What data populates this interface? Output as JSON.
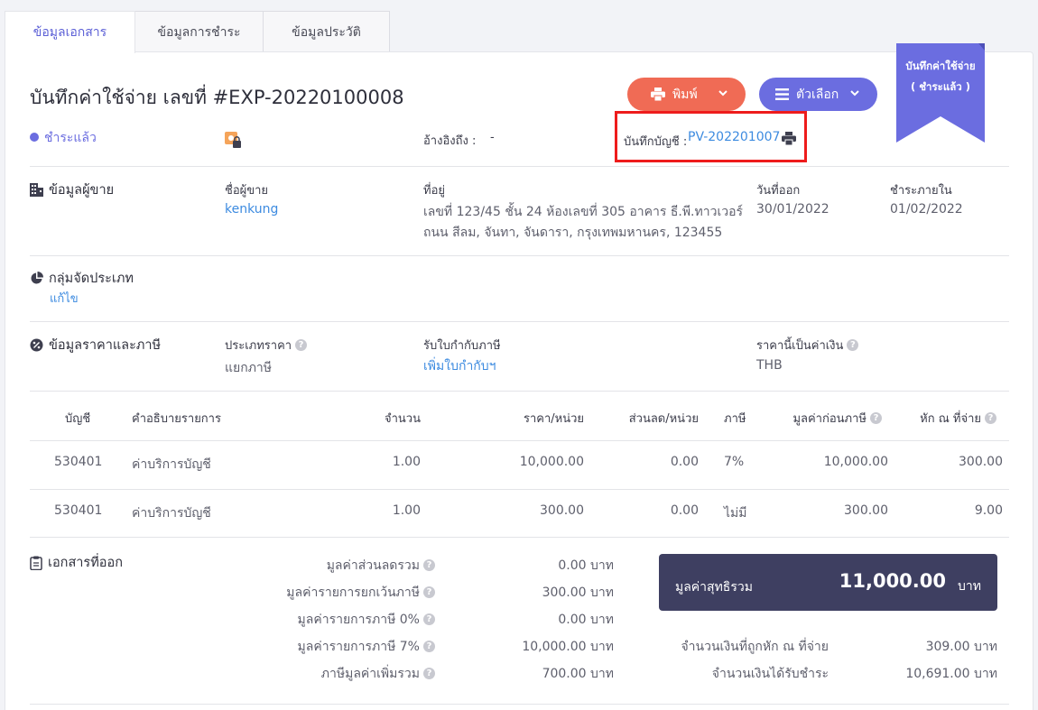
{
  "tabs": [
    "ข้อมูลเอกสาร",
    "ข้อมูลการชำระ",
    "ข้อมูลประวัติ"
  ],
  "header": {
    "title": "บันทึกค่าใช้จ่าย เลขที่ #EXP-20220100008",
    "print_label": "พิมพ์",
    "options_label": "ตัวเลือก",
    "ribbon_line1": "บันทึกค่าใช้จ่าย",
    "ribbon_line2": "( ชำระแล้ว )"
  },
  "status": {
    "label": "ชำระแล้ว",
    "reference_label": "อ้างอิงถึง :",
    "reference_value": "-",
    "account_label": "บันทึกบัญชี :",
    "account_value": "PV-202201007"
  },
  "vendor": {
    "section_title": "ข้อมูลผู้ขาย",
    "name_label": "ชื่อผู้ขาย",
    "name_value": "kenkung",
    "address_label": "ที่อยู่",
    "address_line1": "เลขที่ 123/45 ชั้น 24 ห้องเลขที่ 305 อาคาร ธี.พี.ทาวเวอร์",
    "address_line2": "ถนน สีลม, จันทา, จันดารา, กรุงเทพมหานคร, 123455",
    "issue_date_label": "วันที่ออก",
    "issue_date_value": "30/01/2022",
    "due_date_label": "ชำระภายใน",
    "due_date_value": "01/02/2022"
  },
  "category": {
    "section_title": "กลุ่มจัดประเภท",
    "edit_label": "แก้ไข"
  },
  "pricing": {
    "section_title": "ข้อมูลราคาและภาษี",
    "price_type_label": "ประเภทราคา",
    "price_type_value": "แยกภาษี",
    "tax_invoice_label": "รับใบกำกับภาษี",
    "tax_invoice_value": "เพิ่มใบกำกับฯ",
    "currency_label": "ราคานี้เป็นค่าเงิน",
    "currency_value": "THB"
  },
  "table": {
    "headers": [
      "บัญชี",
      "คำอธิบายรายการ",
      "จำนวน",
      "ราคา/หน่วย",
      "ส่วนลด/หน่วย",
      "ภาษี",
      "มูลค่าก่อนภาษี",
      "หัก ณ ที่จ่าย"
    ],
    "rows": [
      [
        "530401",
        "ค่าบริการบัญชี",
        "1.00",
        "10,000.00",
        "0.00",
        "7%",
        "10,000.00",
        "300.00"
      ],
      [
        "530401",
        "ค่าบริการบัญชี",
        "1.00",
        "300.00",
        "0.00",
        "ไม่มี",
        "300.00",
        "9.00"
      ]
    ]
  },
  "documents": {
    "section_title": "เอกสารที่ออก"
  },
  "summary": {
    "lines": [
      {
        "label": "มูลค่าส่วนลดรวม",
        "value": "0.00 บาท"
      },
      {
        "label": "มูลค่ารายการยกเว้นภาษี",
        "value": "300.00 บาท"
      },
      {
        "label": "มูลค่ารายการภาษี 0%",
        "value": "0.00 บาท"
      },
      {
        "label": "มูลค่ารายการภาษี 7%",
        "value": "10,000.00 บาท"
      },
      {
        "label": "ภาษีมูลค่าเพิ่มรวม",
        "value": "700.00 บาท"
      }
    ],
    "net_label": "มูลค่าสุทธิรวม",
    "net_value": "11,000.00",
    "net_unit": "บาท",
    "withheld_label": "จำนวนเงินที่ถูกหัก ณ ที่จ่าย",
    "withheld_value": "309.00 บาท",
    "received_label": "จำนวนเงินได้รับชำระ",
    "received_value": "10,691.00 บาท"
  },
  "colors": {
    "accent": "#6b6de0",
    "print_button": "#f06b55",
    "total_box": "#3e3f61",
    "link": "#3d8be0"
  }
}
